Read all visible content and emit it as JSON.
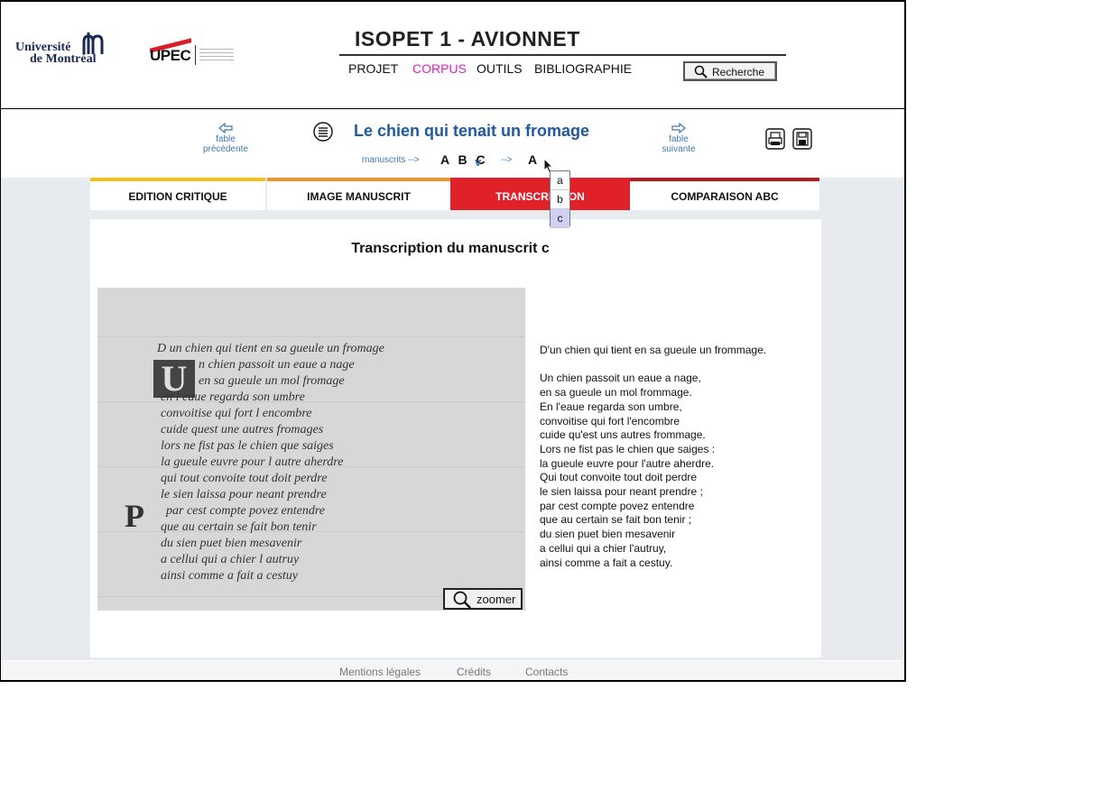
{
  "header": {
    "logo_udem": {
      "line1": "Université",
      "line2": "de Montréal"
    },
    "logo_upec": {
      "text": "UPEC"
    },
    "site_title": "ISOPET 1 - AVIONNET",
    "nav": [
      {
        "label": "PROJET",
        "color": "#111111"
      },
      {
        "label": "CORPUS",
        "color": "#e21ec8"
      },
      {
        "label": "OUTILS",
        "color": "#111111"
      },
      {
        "label": "BIBLIOGRAPHIE",
        "color": "#111111"
      }
    ],
    "search_label": "Recherche"
  },
  "fable_bar": {
    "prev_label": "fable précédente",
    "next_label": "fable suivante",
    "title": "Le chien qui tenait un fromage",
    "manuscripts_label": "manuscrits  -->",
    "manuscript_letters": "A B C",
    "chevron": "v",
    "arrow2": "-->",
    "selected_manuscript": "A"
  },
  "dropdown": {
    "options": [
      "a",
      "b",
      "c"
    ],
    "selected": "c"
  },
  "tabs": [
    {
      "label": "EDITION CRITIQUE"
    },
    {
      "label": "IMAGE MANUSCRIT"
    },
    {
      "label": "TRANSCRIPTION"
    },
    {
      "label": "COMPARAISON ABC"
    }
  ],
  "panel": {
    "title": "Transcription du manuscrit c",
    "zoom_label": "zoomer",
    "manuscript_lines": [
      "D un chien qui tient en sa gueule un fromage",
      "n chien passoit un eaue a nage",
      "en sa gueule un mol fromage",
      "en l eaue regarda son umbre",
      "convoitise qui fort l encombre",
      "cuide quest une autres fromages",
      "lors ne fist pas le chien que saiges",
      "la gueule euvre pour l autre aherdre",
      "qui tout convoite tout doit perdre",
      "le sien laissa pour neant prendre",
      "par cest compte povez entendre",
      "que au certain se fait bon tenir",
      "du sien puet bien mesavenir",
      "a cellui qui a chier l autruy",
      "ainsi comme a fait a cestuy"
    ],
    "transcript_heading": "D'un chien qui tient en sa gueule un frommage.",
    "transcript_lines": [
      "Un chien passoit un eaue a nage,",
      "en sa gueule un mol frommage.",
      "En l'eaue regarda son umbre,",
      "convoitise qui fort l'encombre",
      "cuide qu'est uns autres frommage.",
      "Lors ne fist pas le chien que saiges :",
      "la gueule euvre pour l'autre aherdre.",
      "Qui tout convoite tout doit perdre",
      "le sien laissa pour neant prendre ;",
      "par cest compte povez entendre",
      "que au certain se fait bon tenir ;",
      "du sien puet bien mesavenir",
      "a cellui qui a chier l'autruy,",
      "ainsi comme a fait a cestuy."
    ]
  },
  "footer": {
    "links": [
      "Mentions légales",
      "Crédits",
      "Contacts"
    ]
  }
}
